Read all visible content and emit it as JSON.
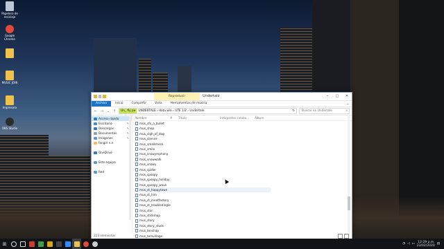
{
  "desktop": {
    "icons": [
      {
        "label": "Papelera de reciclaje",
        "icon": "recycle-bin-icon",
        "color": "#bcc8d6"
      },
      {
        "label": "Google Chrome",
        "icon": "chrome-icon",
        "color": "#e04a3b"
      },
      {
        "label": "",
        "icon": "folder-icon",
        "color": "#f1c24b"
      },
      {
        "label": "MUSIC JOIN",
        "icon": "folder-icon",
        "color": "#f1c24b"
      },
      {
        "label": "Impresora",
        "icon": "printer-icon",
        "color": "#f1c24b"
      },
      {
        "label": "OBS Studio",
        "icon": "obs-icon",
        "color": "#2c2c2c"
      }
    ]
  },
  "window": {
    "title": "Undertale",
    "context_tab": "Reproducir",
    "controls": {
      "minimize": "–",
      "maximize": "□",
      "close": "✕"
    },
    "ribbon_tabs": [
      "Archivo",
      "Inicio",
      "Compartir",
      "Vista",
      "Herramientas de música"
    ],
    "address": {
      "highlighted": "Un_ fly pe",
      "path": "UNDERTALE › data.win › UTE 1/2 › Undertale"
    },
    "search_placeholder": "Buscar en Undertale",
    "columns": [
      "Nombre",
      "#",
      "Título",
      "Intérpretes colabo...",
      "Álbum"
    ],
    "nav": [
      {
        "label": "Acceso rápido",
        "icon": "star-icon",
        "color": "#2b7cd3",
        "pinned": false
      },
      {
        "label": "Escritorio",
        "icon": "desktop-icon",
        "color": "#3b8ed8",
        "pinned": true
      },
      {
        "label": "Descargas",
        "icon": "download-icon",
        "color": "#2b7cd3",
        "pinned": true
      },
      {
        "label": "Documentos",
        "icon": "documents-icon",
        "color": "#8d9fb3",
        "pinned": true
      },
      {
        "label": "Imágenes",
        "icon": "pictures-icon",
        "color": "#5a9bd6",
        "pinned": true
      },
      {
        "label": "fangirl n.n",
        "icon": "folder-icon",
        "color": "#f1c24b",
        "pinned": false
      },
      {
        "label": "",
        "icon": "spacer",
        "color": "#ffffff",
        "pinned": false
      },
      {
        "label": "OneDrive",
        "icon": "onedrive-icon",
        "color": "#2b7cd3",
        "pinned": false
      },
      {
        "label": "",
        "icon": "spacer",
        "color": "#ffffff",
        "pinned": false
      },
      {
        "label": "Este equipo",
        "icon": "computer-icon",
        "color": "#5a9bd6",
        "pinned": false
      },
      {
        "label": "",
        "icon": "spacer",
        "color": "#ffffff",
        "pinned": false
      },
      {
        "label": "Red",
        "icon": "network-icon",
        "color": "#5a9bd6",
        "pinned": false
      }
    ],
    "files": [
      "mus_sfx_a_bullet",
      "mus_shop",
      "mus_sigh_of_dog",
      "mus_silence",
      "mus_smallshock",
      "mus_smile",
      "mus_snowymphony",
      "mus_snowwalk",
      "mus_snowy",
      "mus_spider",
      "mus_spoopy",
      "mus_spoopy_holiday",
      "mus_spoopy_wave",
      "mus_st_happytown",
      "mus_st_him",
      "mus_st_meatfactory",
      "mus_st_troubledingle",
      "mus_star",
      "mus_stickmap",
      "mus_story",
      "mus_story_stuck",
      "mus_tenshop",
      "mus_temvillage",
      "mus_tension"
    ],
    "status": "223 elementos"
  },
  "taskbar": {
    "start": "⊞",
    "items": [
      {
        "icon": "search-icon",
        "color": "#dddddd",
        "active": false
      },
      {
        "icon": "task-view-icon",
        "color": "#dddddd",
        "active": false
      },
      {
        "icon": "game-icon",
        "color": "#d43b2f",
        "active": false
      },
      {
        "icon": "video-icon",
        "color": "#3f9e44",
        "active": false
      },
      {
        "icon": "app-icon",
        "color": "#d8a21a",
        "active": false
      },
      {
        "icon": "mail-icon",
        "color": "#444444",
        "active": false
      },
      {
        "icon": "zoom-icon",
        "color": "#2d8cff",
        "active": false
      },
      {
        "icon": "file-explorer-icon",
        "color": "#f1c24b",
        "active": true
      },
      {
        "icon": "chrome-icon",
        "color": "#e04a3b",
        "active": false
      },
      {
        "icon": "obs-icon",
        "color": "#cccccc",
        "active": false
      }
    ],
    "clock_time": "12:29 p.m.",
    "clock_date": "23/02/2020"
  }
}
